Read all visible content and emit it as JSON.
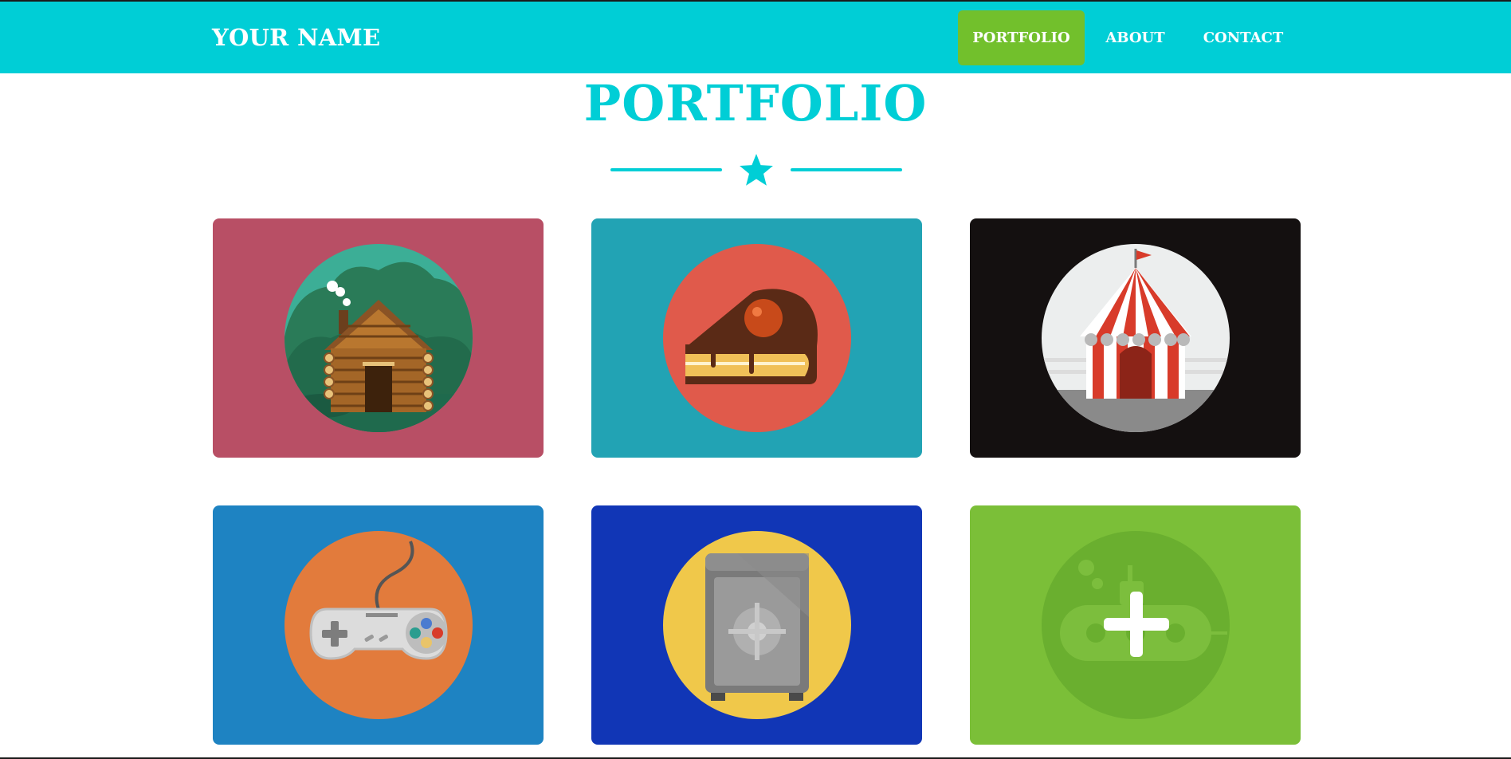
{
  "brand": "YOUR NAME",
  "nav": [
    {
      "label": "PORTFOLIO",
      "active": true
    },
    {
      "label": "ABOUT",
      "active": false
    },
    {
      "label": "CONTACT",
      "active": false
    }
  ],
  "section_title": "PORTFOLIO",
  "divider_icon": "star-icon",
  "colors": {
    "navbar": "#00ced6",
    "accent": "#72c02c",
    "title": "#00ced6"
  },
  "portfolio_items": [
    {
      "icon": "cabin-icon",
      "background": "#b84f65",
      "circle": "#3cae96"
    },
    {
      "icon": "cake-slice-icon",
      "background": "#22a3b4",
      "circle": "#e05a4b"
    },
    {
      "icon": "circus-tent-icon",
      "background": "#141010",
      "circle": "#eceeee"
    },
    {
      "icon": "game-controller-icon",
      "background": "#1e83c2",
      "circle": "#e27b3c"
    },
    {
      "icon": "safe-icon",
      "background": "#1136b6",
      "circle": "#f0c84a"
    },
    {
      "icon": "submarine-icon",
      "background": "#7bbf38",
      "circle": "#6aaf2f",
      "overlay_icon": "plus-icon"
    }
  ]
}
